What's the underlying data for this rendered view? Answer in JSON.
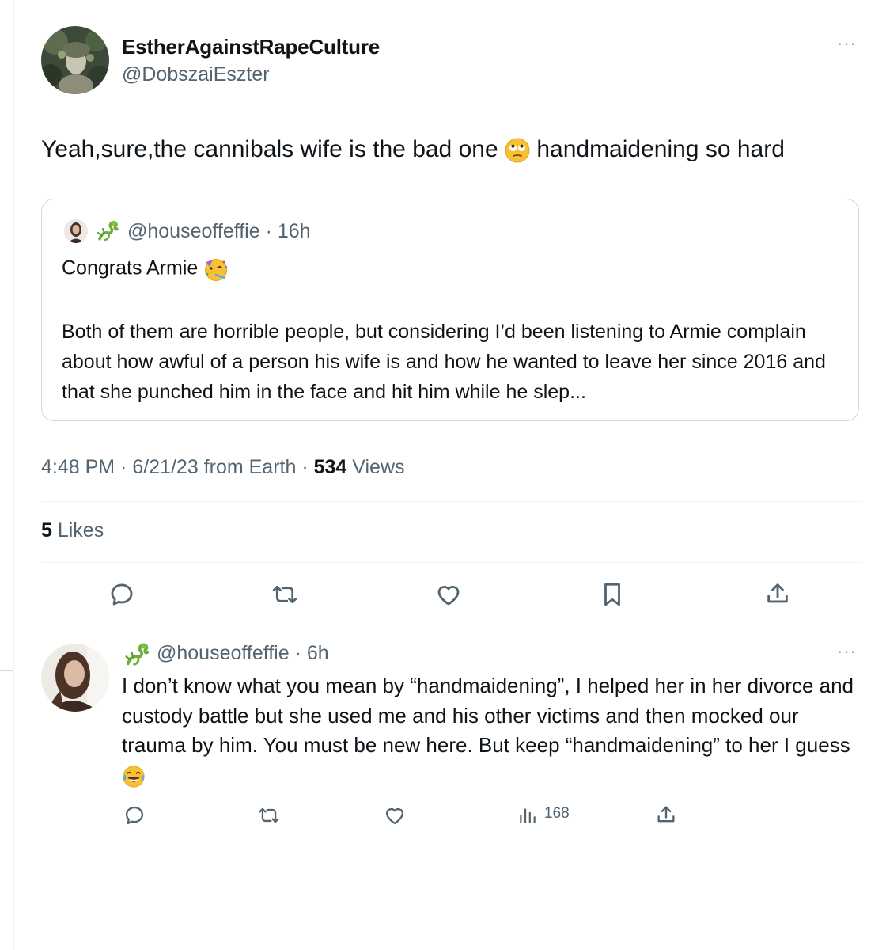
{
  "tweet": {
    "display_name": "EstherAgainstRapeCulture",
    "handle": "@DobszaiEszter",
    "more_label": "···",
    "text_before_emoji": "Yeah,sure,the cannibals wife is the bad one",
    "text_after_emoji": "handmaidening so hard",
    "timestamp": "4:48 PM · 6/21/23 from Earth · ",
    "views_count": "534",
    "views_label": " Views",
    "likes_count": "5",
    "likes_label": " Likes"
  },
  "quote": {
    "meta": "@houseoffeffie · 16h",
    "first_line": "Congrats Armie",
    "body": "Both of them are horrible people, but considering I’d been listening to Armie complain about how awful of a person his wife is and how he wanted to leave her since 2016 and that she punched him in the face and hit him while he slep..."
  },
  "reply": {
    "meta": "@houseoffeffie · 6h",
    "more_label": "···",
    "body": "I don’t know what you mean by “handmaidening”, I helped her in her divorce and custody battle but she used me and his other victims and then mocked our trauma by him. You must be new here. But keep “handmaidening” to her I guess",
    "views": "168"
  },
  "icons": {
    "reply": "reply-icon",
    "retweet": "retweet-icon",
    "like": "heart-icon",
    "bookmark": "bookmark-icon",
    "share": "share-icon",
    "views": "views-bar-icon",
    "dragon": "dragon-emoji-icon"
  },
  "colors": {
    "text": "#0f1419",
    "secondary": "#536471",
    "border": "#cfd9de",
    "dragon_green": "#6fae3a",
    "emoji_yellow": "#f7c232"
  }
}
